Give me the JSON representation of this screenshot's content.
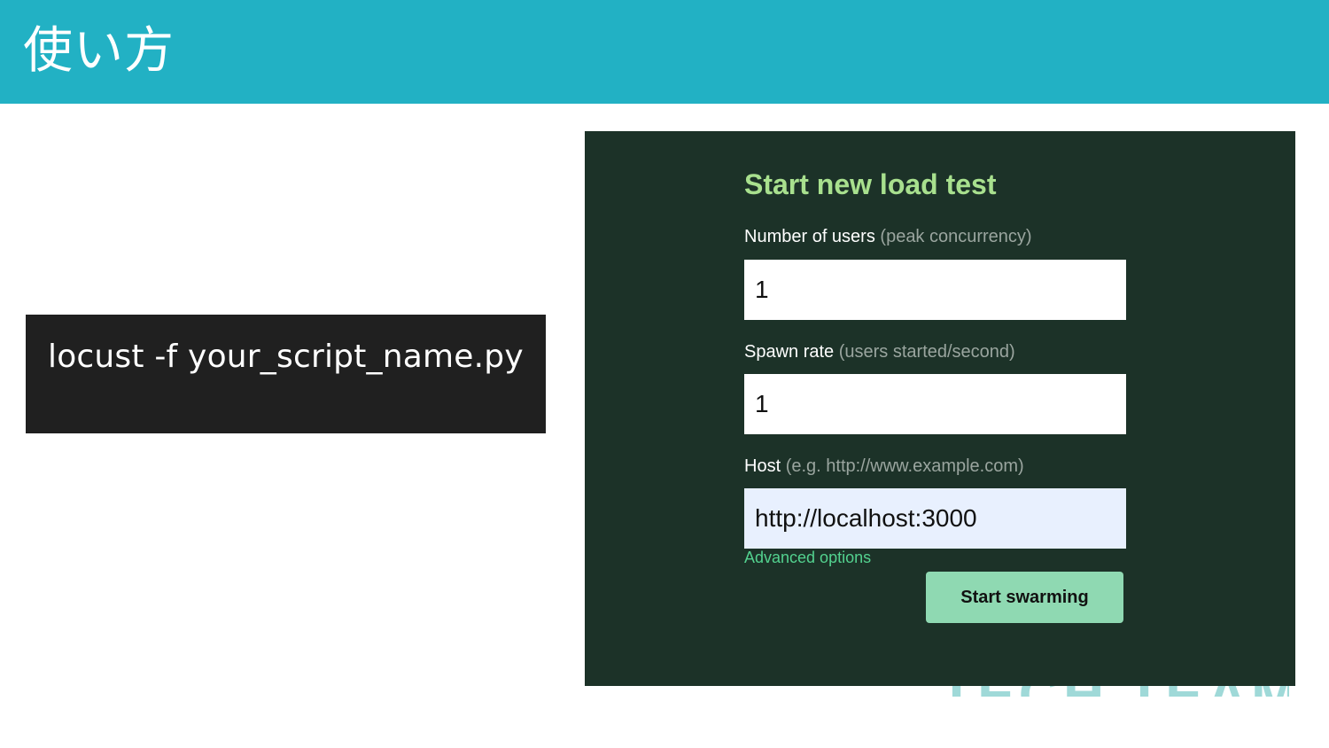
{
  "slide": {
    "title": "使い方",
    "command": "locust -f your_script_name.py",
    "watermark": "TECH TEAM"
  },
  "form": {
    "title": "Start new load test",
    "users": {
      "label": "Number of users",
      "hint": "(peak concurrency)",
      "value": "1"
    },
    "spawn_rate": {
      "label": "Spawn rate",
      "hint": "(users started/second)",
      "value": "1"
    },
    "host": {
      "label": "Host",
      "hint": "(e.g. http://www.example.com)",
      "value": "http://localhost:3000"
    },
    "advanced_link": "Advanced options",
    "start_button": "Start swarming"
  },
  "colors": {
    "header": "#22b1c4",
    "command_box": "#202020",
    "panel_background": "#1c3228",
    "form_title": "#a8e08e",
    "link": "#53d28f",
    "button": "#8fd9b2",
    "autofill_input": "#e8f0fe"
  }
}
